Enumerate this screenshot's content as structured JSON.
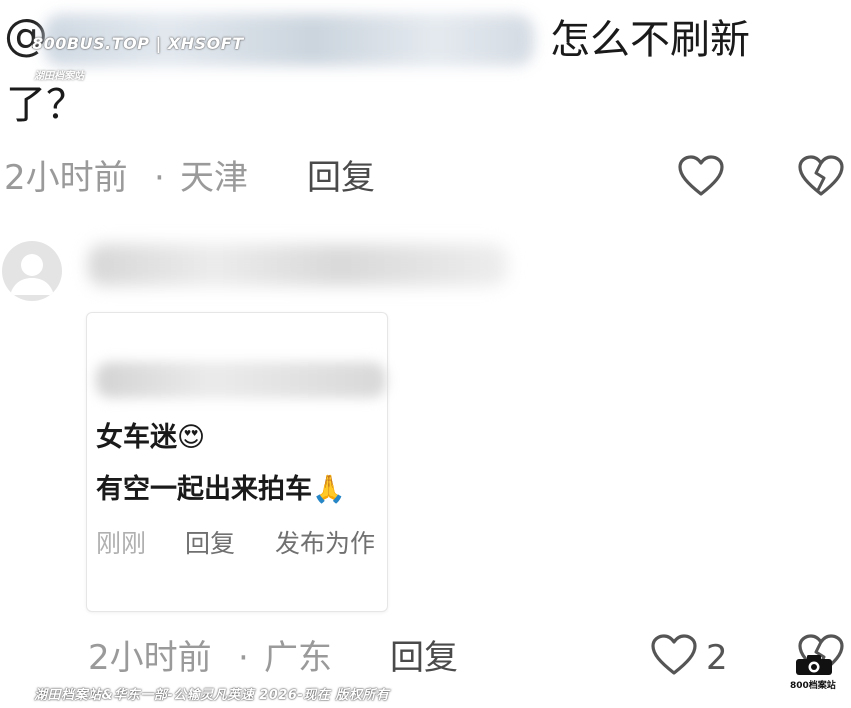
{
  "comment1": {
    "at_symbol": "@",
    "text_line1": "怎么不刷新",
    "text_line2": "了？",
    "time": "2小时前",
    "separator": "·",
    "location": "天津",
    "reply_label": "回复"
  },
  "comment2": {
    "time": "2小时前",
    "separator": "·",
    "location": "广东",
    "reply_label": "回复",
    "like_count": "2",
    "card": {
      "line1": "女车迷😍",
      "line2": "有空一起出来拍车🙏",
      "meta_time": "刚刚",
      "meta_reply": "回复",
      "meta_publish": "发布为作"
    }
  },
  "watermarks": {
    "top": "800BUS.TOP | XHSOFT",
    "top_sub": "湖田档案站",
    "bottom": "湖田档案站&华东一部-公输灵凡英速 2026-现在 版权所有",
    "logo_text": "800档案站"
  },
  "colors": {
    "meta_gray": "#9a9a9a",
    "reply_gray": "#4a4a4a",
    "icon_stroke": "#555555"
  },
  "icons": {
    "like": "heart-outline-icon",
    "dislike": "broken-heart-outline-icon",
    "avatar": "default-avatar-icon",
    "camera": "camera-icon"
  }
}
